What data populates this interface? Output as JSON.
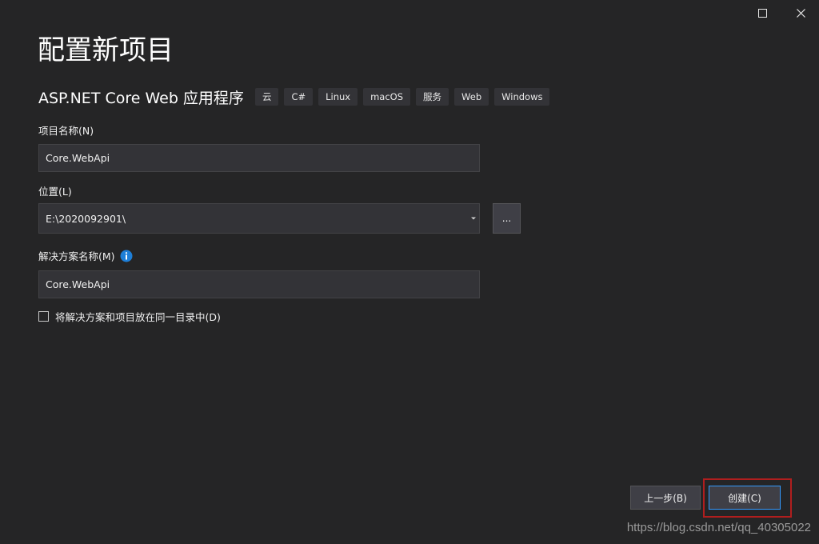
{
  "window": {
    "maximize_icon": "maximize-icon",
    "close_icon": "close-icon"
  },
  "page": {
    "title": "配置新项目"
  },
  "template": {
    "name": "ASP.NET Core Web 应用程序",
    "tags": [
      "云",
      "C#",
      "Linux",
      "macOS",
      "服务",
      "Web",
      "Windows"
    ]
  },
  "form": {
    "project_name_label": "项目名称(N)",
    "project_name_value": "Core.WebApi",
    "location_label": "位置(L)",
    "location_value": "E:\\2020092901\\",
    "browse_label": "...",
    "solution_name_label": "解决方案名称(M)",
    "solution_name_value": "Core.WebApi",
    "info_icon": "info-icon",
    "same_dir_label": "将解决方案和项目放在同一目录中(D)",
    "same_dir_checked": false
  },
  "footer": {
    "back_label": "上一步(B)",
    "create_label": "创建(C)"
  },
  "watermark": "https://blog.csdn.net/qq_40305022",
  "colors": {
    "background": "#252526",
    "input_bg": "#333337",
    "accent": "#3399ff",
    "highlight": "#b01e1e"
  }
}
